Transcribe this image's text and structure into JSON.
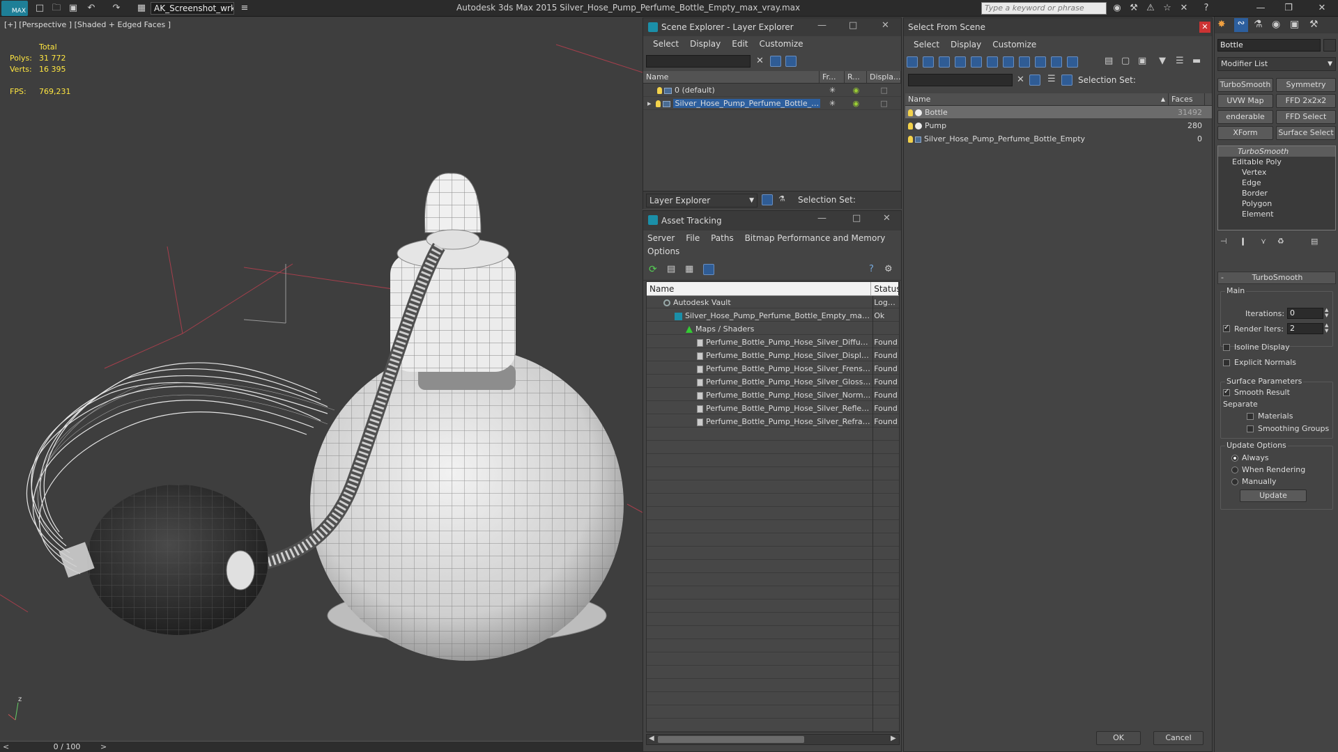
{
  "app": {
    "title": "Autodesk 3ds Max  2015    Silver_Hose_Pump_Perfume_Bottle_Empty_max_vray.max",
    "workspace": "AK_Screenshot_wrksp",
    "search_placeholder": "Type a keyword or phrase"
  },
  "viewport": {
    "label": "[+] [Perspective ] [Shaded + Edged Faces ]",
    "stats": {
      "total_label": "Total",
      "polys_label": "Polys:",
      "polys_value": "31 772",
      "verts_label": "Verts:",
      "verts_value": "16 395",
      "fps_label": "FPS:",
      "fps_value": "769,231"
    }
  },
  "timeline": {
    "label": "0 / 100"
  },
  "scene_explorer": {
    "title": "Scene Explorer - Layer Explorer",
    "menu": [
      "Select",
      "Display",
      "Edit",
      "Customize"
    ],
    "columns": [
      "Name",
      "Fr...",
      "R...",
      "Displa..."
    ],
    "rows": [
      {
        "name": "0 (default)"
      },
      {
        "name": "Silver_Hose_Pump_Perfume_Bottle_E..."
      }
    ],
    "footer_dropdown": "Layer Explorer",
    "footer_selection": "Selection Set:"
  },
  "asset_tracking": {
    "title": "Asset Tracking",
    "menu": [
      "Server",
      "File",
      "Paths",
      "Bitmap Performance and Memory",
      "Options"
    ],
    "columns": [
      "Name",
      "Status"
    ],
    "rows": [
      {
        "name": "Autodesk Vault",
        "status": "Logged"
      },
      {
        "name": "Silver_Hose_Pump_Perfume_Bottle_Empty_max_...",
        "status": "Ok"
      },
      {
        "name": "Maps / Shaders",
        "status": ""
      },
      {
        "name": "Perfume_Bottle_Pump_Hose_Silver_Diffus...",
        "status": "Found"
      },
      {
        "name": "Perfume_Bottle_Pump_Hose_Silver_Displa...",
        "status": "Found"
      },
      {
        "name": "Perfume_Bottle_Pump_Hose_Silver_Frense...",
        "status": "Found"
      },
      {
        "name": "Perfume_Bottle_Pump_Hose_Silver_Glossi...",
        "status": "Found"
      },
      {
        "name": "Perfume_Bottle_Pump_Hose_Silver_Norm...",
        "status": "Found"
      },
      {
        "name": "Perfume_Bottle_Pump_Hose_Silver_Reflec...",
        "status": "Found"
      },
      {
        "name": "Perfume_Bottle_Pump_Hose_Silver_Refrac...",
        "status": "Found"
      }
    ]
  },
  "select_from_scene": {
    "title": "Select From Scene",
    "menu": [
      "Select",
      "Display",
      "Customize"
    ],
    "selection_set": "Selection Set:",
    "columns": [
      "Name",
      "Faces"
    ],
    "rows": [
      {
        "name": "Bottle",
        "faces": "31492"
      },
      {
        "name": "Pump",
        "faces": "280"
      },
      {
        "name": "Silver_Hose_Pump_Perfume_Bottle_Empty",
        "faces": "0"
      }
    ],
    "ok": "OK",
    "cancel": "Cancel"
  },
  "command_panel": {
    "object_name": "Bottle",
    "modifier_list": "Modifier List",
    "buttons": [
      "TurboSmooth",
      "Symmetry",
      "UVW Map",
      "FFD 2x2x2",
      "enderable Spli",
      "FFD Select",
      "XForm",
      "Surface Select"
    ],
    "stack": [
      "TurboSmooth",
      "Editable Poly",
      "Vertex",
      "Edge",
      "Border",
      "Polygon",
      "Element"
    ],
    "rollout_title": "TurboSmooth",
    "main_label": "Main",
    "iterations_label": "Iterations:",
    "iterations_value": "0",
    "render_iters_label": "Render Iters:",
    "render_iters_value": "2",
    "isoline": "Isoline Display",
    "explicit_normals": "Explicit Normals",
    "surface_params": "Surface Parameters",
    "smooth_result": "Smooth Result",
    "separate": "Separate",
    "materials": "Materials",
    "smoothing_groups": "Smoothing Groups",
    "update_options": "Update Options",
    "always": "Always",
    "when_rendering": "When Rendering",
    "manually": "Manually",
    "update": "Update"
  }
}
